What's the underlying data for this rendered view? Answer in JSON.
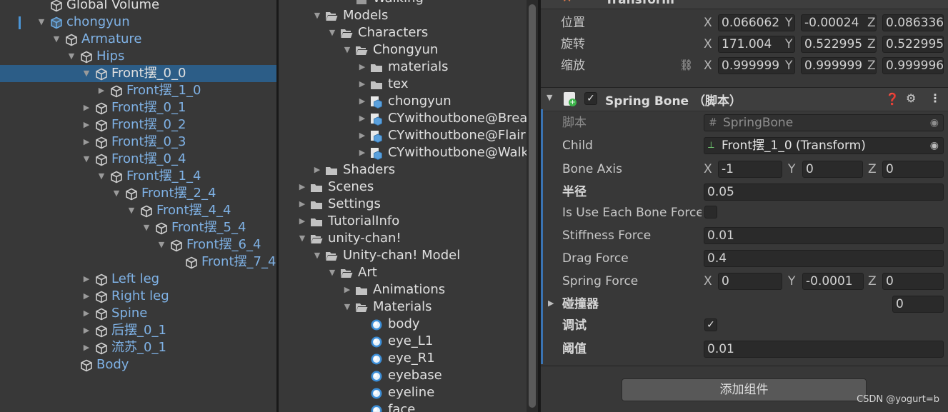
{
  "hierarchy": {
    "items": [
      {
        "label": "Global Volume",
        "depth": 0,
        "arrow": "",
        "color": "white"
      },
      {
        "label": "chongyun",
        "depth": 0,
        "arrow": "down",
        "color": "blue",
        "prefab": true
      },
      {
        "label": "Armature",
        "depth": 1,
        "arrow": "down",
        "color": "blue"
      },
      {
        "label": "Hips",
        "depth": 2,
        "arrow": "down",
        "color": "blue"
      },
      {
        "label": "Front摆_0_0",
        "depth": 3,
        "arrow": "down",
        "color": "white",
        "selected": true
      },
      {
        "label": "Front摆_1_0",
        "depth": 4,
        "arrow": "right",
        "color": "blue"
      },
      {
        "label": "Front摆_0_1",
        "depth": 3,
        "arrow": "right",
        "color": "blue"
      },
      {
        "label": "Front摆_0_2",
        "depth": 3,
        "arrow": "right",
        "color": "blue"
      },
      {
        "label": "Front摆_0_3",
        "depth": 3,
        "arrow": "right",
        "color": "blue"
      },
      {
        "label": "Front摆_0_4",
        "depth": 3,
        "arrow": "down",
        "color": "blue"
      },
      {
        "label": "Front摆_1_4",
        "depth": 4,
        "arrow": "down",
        "color": "blue"
      },
      {
        "label": "Front摆_2_4",
        "depth": 5,
        "arrow": "down",
        "color": "blue"
      },
      {
        "label": "Front摆_4_4",
        "depth": 6,
        "arrow": "down",
        "color": "blue"
      },
      {
        "label": "Front摆_5_4",
        "depth": 7,
        "arrow": "down",
        "color": "blue"
      },
      {
        "label": "Front摆_6_4",
        "depth": 8,
        "arrow": "down",
        "color": "blue"
      },
      {
        "label": "Front摆_7_4",
        "depth": 9,
        "arrow": "",
        "color": "blue"
      },
      {
        "label": "Left leg",
        "depth": 3,
        "arrow": "right",
        "color": "blue"
      },
      {
        "label": "Right leg",
        "depth": 3,
        "arrow": "right",
        "color": "blue"
      },
      {
        "label": "Spine",
        "depth": 3,
        "arrow": "right",
        "color": "blue"
      },
      {
        "label": "后摆_0_1",
        "depth": 3,
        "arrow": "right",
        "color": "blue"
      },
      {
        "label": "流苏_0_1",
        "depth": 3,
        "arrow": "right",
        "color": "blue"
      },
      {
        "label": "Body",
        "depth": 2,
        "arrow": "",
        "color": "blue"
      }
    ]
  },
  "project": {
    "items": [
      {
        "label": "Walking",
        "depth": 3,
        "arrow": "",
        "type": "anim"
      },
      {
        "label": "Models",
        "depth": 1,
        "arrow": "down",
        "type": "folder-open"
      },
      {
        "label": "Characters",
        "depth": 2,
        "arrow": "down",
        "type": "folder-open"
      },
      {
        "label": "Chongyun",
        "depth": 3,
        "arrow": "down",
        "type": "folder-open"
      },
      {
        "label": "materials",
        "depth": 4,
        "arrow": "right",
        "type": "folder"
      },
      {
        "label": "tex",
        "depth": 4,
        "arrow": "right",
        "type": "folder"
      },
      {
        "label": "chongyun",
        "depth": 4,
        "arrow": "right",
        "type": "model"
      },
      {
        "label": "CYwithoutbone@Breathing",
        "depth": 4,
        "arrow": "right",
        "type": "model"
      },
      {
        "label": "CYwithoutbone@Flair",
        "depth": 4,
        "arrow": "right",
        "type": "model"
      },
      {
        "label": "CYwithoutbone@Walking",
        "depth": 4,
        "arrow": "right",
        "type": "model"
      },
      {
        "label": "Shaders",
        "depth": 1,
        "arrow": "right",
        "type": "folder"
      },
      {
        "label": "Scenes",
        "depth": 0,
        "arrow": "right",
        "type": "folder"
      },
      {
        "label": "Settings",
        "depth": 0,
        "arrow": "right",
        "type": "folder"
      },
      {
        "label": "TutorialInfo",
        "depth": 0,
        "arrow": "right",
        "type": "folder"
      },
      {
        "label": "unity-chan!",
        "depth": 0,
        "arrow": "down",
        "type": "folder-open"
      },
      {
        "label": "Unity-chan! Model",
        "depth": 1,
        "arrow": "down",
        "type": "folder-open"
      },
      {
        "label": "Art",
        "depth": 2,
        "arrow": "down",
        "type": "folder-open"
      },
      {
        "label": "Animations",
        "depth": 3,
        "arrow": "right",
        "type": "folder"
      },
      {
        "label": "Materials",
        "depth": 3,
        "arrow": "down",
        "type": "folder-open"
      },
      {
        "label": "body",
        "depth": 4,
        "arrow": "",
        "type": "material"
      },
      {
        "label": "eye_L1",
        "depth": 4,
        "arrow": "",
        "type": "material"
      },
      {
        "label": "eye_R1",
        "depth": 4,
        "arrow": "",
        "type": "material"
      },
      {
        "label": "eyebase",
        "depth": 4,
        "arrow": "",
        "type": "material"
      },
      {
        "label": "eyeline",
        "depth": 4,
        "arrow": "",
        "type": "material"
      },
      {
        "label": "face",
        "depth": 4,
        "arrow": "",
        "type": "material"
      }
    ]
  },
  "inspector": {
    "transform": {
      "title": "Transform",
      "position": {
        "label": "位置",
        "x": "0.066062",
        "y": "-0.00024",
        "z": "0.086336"
      },
      "rotation": {
        "label": "旋转",
        "x": "171.004",
        "y": "0.522995",
        "z": "0.522995"
      },
      "scale": {
        "label": "缩放",
        "x": "0.999999",
        "y": "0.999999",
        "z": "0.999996"
      }
    },
    "component": {
      "title": "Spring Bone （脚本）",
      "script_label": "脚本",
      "script_value": "SpringBone",
      "child_label": "Child",
      "child_value": "Front摆_1_0 (Transform)",
      "bone_axis_label": "Bone Axis",
      "bone_axis": {
        "x": "-1",
        "y": "0",
        "z": "0"
      },
      "radius_label": "半径",
      "radius_value": "0.05",
      "use_each_label": "Is Use Each Bone Force",
      "stiffness_label": "Stiffness Force",
      "stiffness_value": "0.01",
      "drag_label": "Drag Force",
      "drag_value": "0.4",
      "spring_label": "Spring Force",
      "spring": {
        "x": "0",
        "y": "-0.0001",
        "z": "0"
      },
      "colliders_label": "碰撞器",
      "colliders_count": "0",
      "debug_label": "调试",
      "threshold_label": "阈值",
      "threshold_value": "0.01"
    },
    "add_component": "添加组件",
    "axis": {
      "x": "X",
      "y": "Y",
      "z": "Z"
    }
  },
  "watermark": "CSDN @yogurt=b",
  "colors": {
    "selection": "#2c5d87",
    "prefab_blue": "#7fb2e6",
    "panel": "#383838",
    "field": "#2a2a2a"
  }
}
